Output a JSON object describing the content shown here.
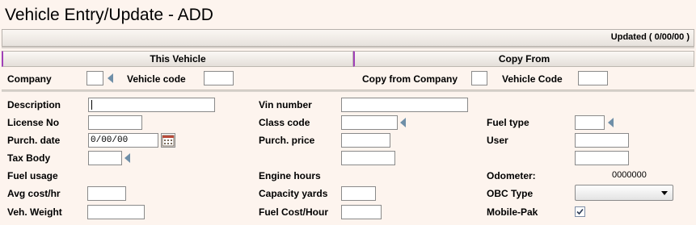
{
  "window": {
    "title": "Vehicle Entry/Update - ADD"
  },
  "status": {
    "updated_text": "Updated ( 0/00/00 )"
  },
  "sections": {
    "this_vehicle": "This Vehicle",
    "copy_from": "Copy From"
  },
  "top_row": {
    "company_label": "Company",
    "vehicle_code_label": "Vehicle code",
    "copy_from_company_label": "Copy from Company",
    "copy_vehicle_code_label": "Vehicle Code"
  },
  "form": {
    "description_label": "Description",
    "license_label": "License No",
    "purch_date_label": "Purch. date",
    "purch_date_value": "0/00/00",
    "tax_body_label": "Tax Body",
    "fuel_usage_label": "Fuel usage",
    "avg_cost_label": "Avg cost/hr",
    "veh_weight_label": "Veh. Weight",
    "vin_label": "Vin number",
    "class_code_label": "Class code",
    "purch_price_label": "Purch. price",
    "engine_hours_label": "Engine hours",
    "capacity_label": "Capacity yards",
    "fuel_cost_label": "Fuel Cost/Hour",
    "fuel_type_label": "Fuel type",
    "user_label": "User",
    "odometer_label": "Odometer:",
    "odometer_value": "0000000",
    "obc_type_label": "OBC Type",
    "obc_type_value": "",
    "mobile_pak_label": "Mobile-Pak",
    "mobile_pak_checked": true
  },
  "icons": [
    "lookup-arrow-icon",
    "calendar-icon",
    "chevron-down-icon",
    "checkmark-icon"
  ],
  "colors": {
    "background": "#fdf4ee",
    "section_accent": "#a040b8",
    "arrow": "#6f8fa8"
  }
}
